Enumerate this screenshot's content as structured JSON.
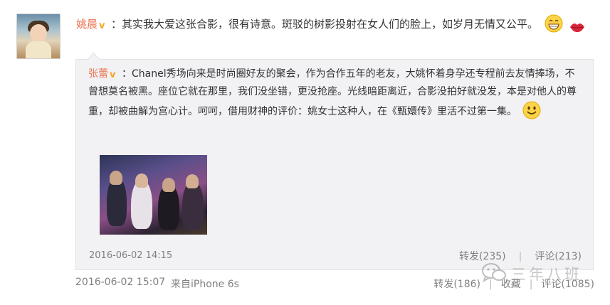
{
  "post": {
    "author": "姚晨",
    "verified_badge": "v",
    "separator": "：",
    "text": "其实我大爱这张合影，很有诗意。斑驳的树影投射在女人们的脸上，如岁月无情又公平。",
    "emojis": [
      "grinning-face-icon",
      "lips-icon"
    ],
    "time": "2016-06-02 15:07",
    "source": "来自iPhone 6s",
    "repost": "转发(186)",
    "favorite": "收藏",
    "comment": "评论(1085)"
  },
  "quoted": {
    "author": "张蕾",
    "verified_badge": "v",
    "separator": "：",
    "text": "Chanel秀场向来是时尚圈好友的聚会，作为合作五年的老友，大姚怀着身孕还专程前去友情捧场，不曾想莫名被黑。座位它就在那里，我们没坐错，更没抢座。光线暗距离近，合影没拍好就没发，本是对他人的尊重，却被曲解为宫心计。呵呵，借用财神的评价：姚女士这种人，在《甄嬛传》里活不过第一集。",
    "emoji": "smiley-icon",
    "time": "2016-06-02 14:15",
    "repost": "转发(235)",
    "comment": "评论(213)",
    "divider": "|"
  },
  "watermark": {
    "text": "三年八班",
    "icon": "wechat-icon"
  },
  "colors": {
    "username": "#eb7350",
    "badge": "#f5a623",
    "meta": "#808080",
    "quote_bg": "#f2f2f5"
  }
}
